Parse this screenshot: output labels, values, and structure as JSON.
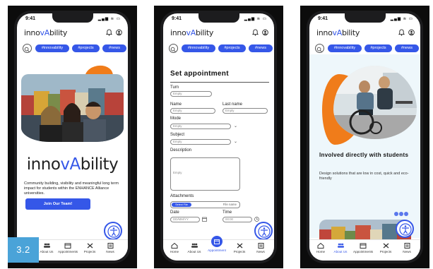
{
  "badge": "3.2",
  "status": {
    "time": "9:41"
  },
  "brand": {
    "logo_prefix": "inno",
    "logo_accent": "vA",
    "logo_suffix": "bility"
  },
  "tags": [
    "#innovability",
    "#projects",
    "#news"
  ],
  "nav": {
    "screen1": [
      "About Us",
      "Appointments",
      "Projects",
      "News"
    ],
    "screen23": [
      "Home",
      "About Us",
      "Appointment",
      "Projects",
      "News"
    ],
    "screen3": [
      "Home",
      "About Us",
      "Appointments",
      "Projects",
      "News"
    ]
  },
  "screen1": {
    "hero_prefix": "inno",
    "hero_accent": "vA",
    "hero_suffix": "bility",
    "body": "Community building, visibility and meaningful long term impact for students within the ENHANCE Alliance universities.",
    "cta": "Join Our Team!"
  },
  "screen2": {
    "title": "Set appointment",
    "turn_label": "Turn",
    "turn_placeholder": "Empty",
    "name_label": "Name",
    "name_placeholder": "Empty",
    "lastname_label": "Last name",
    "lastname_placeholder": "Empty",
    "mode_label": "Mode",
    "mode_placeholder": "Empty",
    "subject_label": "Subject",
    "subject_placeholder": "Empty",
    "description_label": "Description",
    "description_placeholder": "Empty",
    "attachments_label": "Attachments",
    "select_file": "Select File",
    "file_name": "File name",
    "date_label": "Date",
    "date_placeholder": "DD/MM/YY",
    "time_label": "Time",
    "time_placeholder": "00:00"
  },
  "screen3": {
    "heading": "Involved directly with students",
    "body": "Design solutions that are low in cost, quick and eco-friendly"
  },
  "colors": {
    "primary": "#3557e8",
    "orange": "#f07c1a",
    "badge": "#4aa3d8",
    "light_bg": "#eef7fb"
  }
}
